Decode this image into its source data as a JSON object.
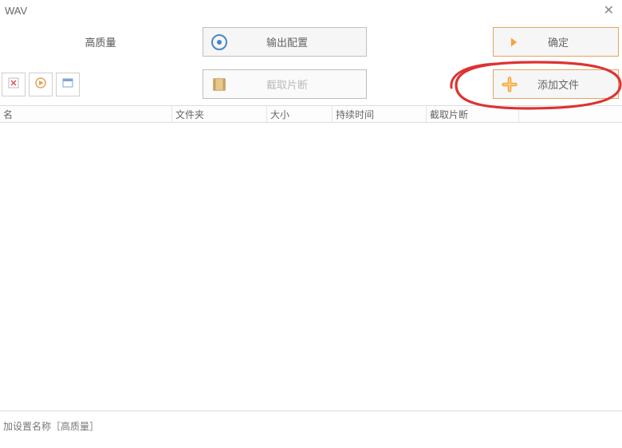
{
  "title": "WAV",
  "quality_label": "高质量",
  "buttons": {
    "output_config": "输出配置",
    "ok": "确定",
    "cut_segment": "截取片断",
    "add_files": "添加文件"
  },
  "columns": {
    "filename": "名",
    "folder": "文件夹",
    "size": "大小",
    "duration": "持续时间",
    "cut_segment": "截取片断"
  },
  "status_line": "加设置名称［高质量］",
  "icons": {
    "delete": "delete-icon",
    "play": "play-icon",
    "preview": "preview-icon",
    "settings": "settings-icon",
    "arrow": "arrow-icon",
    "film": "film-icon",
    "plus": "plus-icon"
  }
}
